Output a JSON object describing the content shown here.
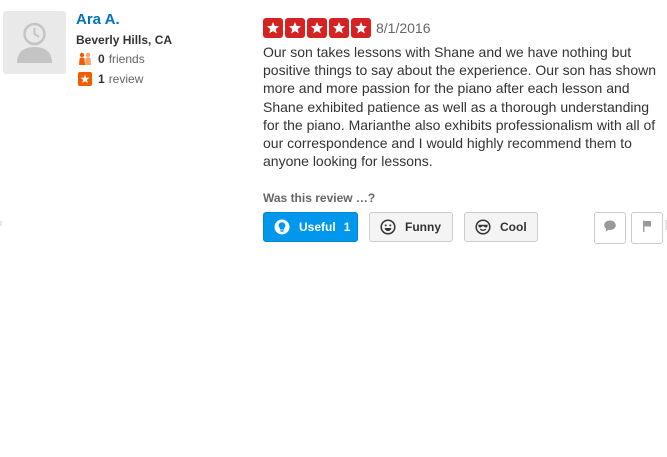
{
  "user": {
    "name": "Ara A.",
    "location": "Beverly Hills, CA",
    "friends_count": "0",
    "friends_label": "friends",
    "reviews_count": "1",
    "reviews_label": "review"
  },
  "review": {
    "rating": 5,
    "max_rating": 5,
    "date": "8/1/2016",
    "text": "Our son takes lessons with Shane and we have nothing but positive things to say about the experience. Our son has shown more and more passion for the piano after each lesson and Shane exhibited patience as well as a thorough understanding for the piano. Marianthe also exhibits professionalism with all of our correspondence and I would highly recommend them to anyone looking for lessons."
  },
  "votes": {
    "prompt": "Was this review …?",
    "useful_label": "Useful",
    "useful_count": "1",
    "funny_label": "Funny",
    "cool_label": "Cool"
  },
  "colors": {
    "link": "#0073bb",
    "star": "#d32323",
    "useful_active": "#0097ec"
  },
  "icons": {
    "avatar": "default-user-avatar-icon",
    "friends": "friends-icon",
    "reviews": "review-star-icon",
    "useful": "lightbulb-icon",
    "funny": "smiley-face-icon",
    "cool": "sunglasses-face-icon",
    "comment": "speech-bubble-icon",
    "flag": "flag-icon"
  }
}
